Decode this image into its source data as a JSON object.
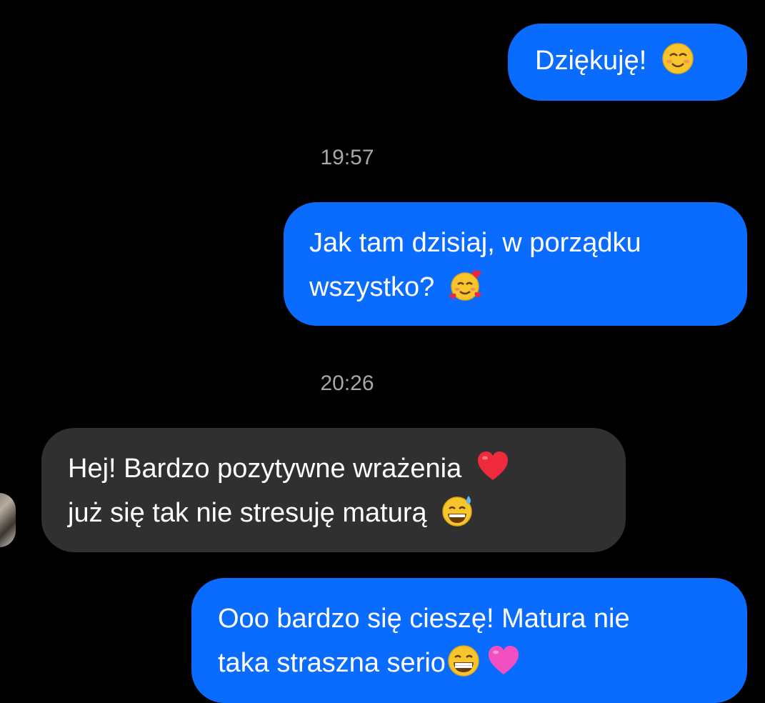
{
  "messages": [
    {
      "direction": "outgoing",
      "lines": [
        "Dziękuję! "
      ],
      "emoji": [
        "smiling-face-emoji"
      ]
    },
    {
      "timestamp": "19:57"
    },
    {
      "direction": "outgoing",
      "lines": [
        "Jak tam dzisiaj, w porządku",
        "wszystko? "
      ],
      "emoji": [
        "smiling-face-with-hearts-emoji"
      ]
    },
    {
      "timestamp": "20:26"
    },
    {
      "direction": "incoming",
      "lines": [
        "Hej! Bardzo pozytywne wrażenia ",
        "już się tak nie stresuję maturą "
      ],
      "emoji": [
        "red-heart-emoji",
        "grinning-sweat-emoji"
      ]
    },
    {
      "direction": "outgoing",
      "lines": [
        "Ooo bardzo się cieszę! Matura nie",
        "taka straszna serio"
      ],
      "emoji": [
        "beaming-face-emoji",
        "pink-heart-emoji"
      ]
    }
  ],
  "colors": {
    "background": "#000000",
    "outgoing_bubble": "#0a6cff",
    "incoming_bubble": "#303030",
    "timestamp_text": "#a7a7ab"
  }
}
